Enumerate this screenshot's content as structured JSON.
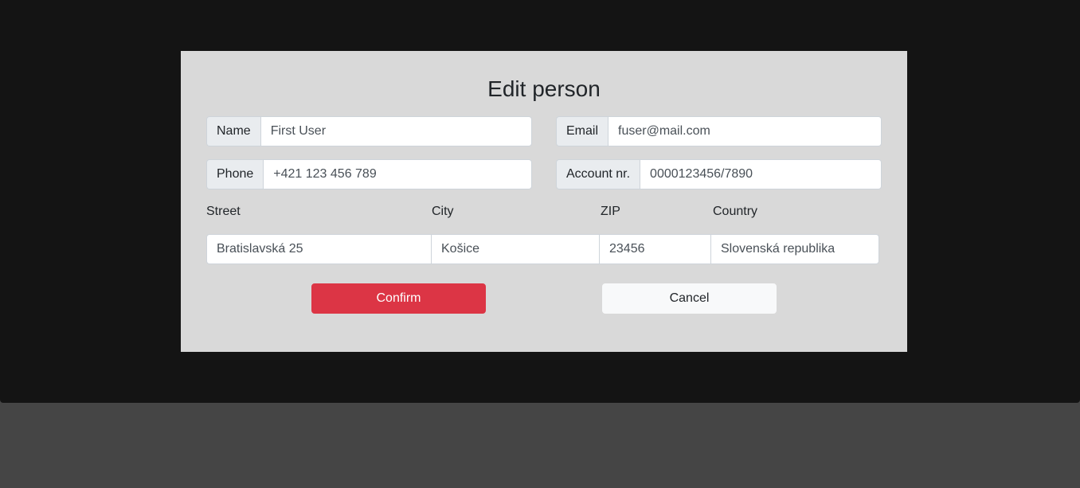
{
  "dialog": {
    "title": "Edit person",
    "name": {
      "label": "Name",
      "value": "First User"
    },
    "email": {
      "label": "Email",
      "value": "fuser@mail.com"
    },
    "phone": {
      "label": "Phone",
      "value": "+421 123 456 789"
    },
    "account": {
      "label": "Account nr.",
      "value": "0000123456/7890"
    },
    "address": {
      "street_label": "Street",
      "city_label": "City",
      "zip_label": "ZIP",
      "country_label": "Country",
      "street": "Bratislavská 25",
      "city": "Košice",
      "zip": "23456",
      "country": "Slovenská republika"
    },
    "confirm_label": "Confirm",
    "cancel_label": "Cancel"
  },
  "colors": {
    "confirm": "#dc3545",
    "cancel": "#f8f9fa",
    "dialog_bg": "#d9d9d9",
    "backdrop": "#141414",
    "page_bg": "#454545"
  }
}
